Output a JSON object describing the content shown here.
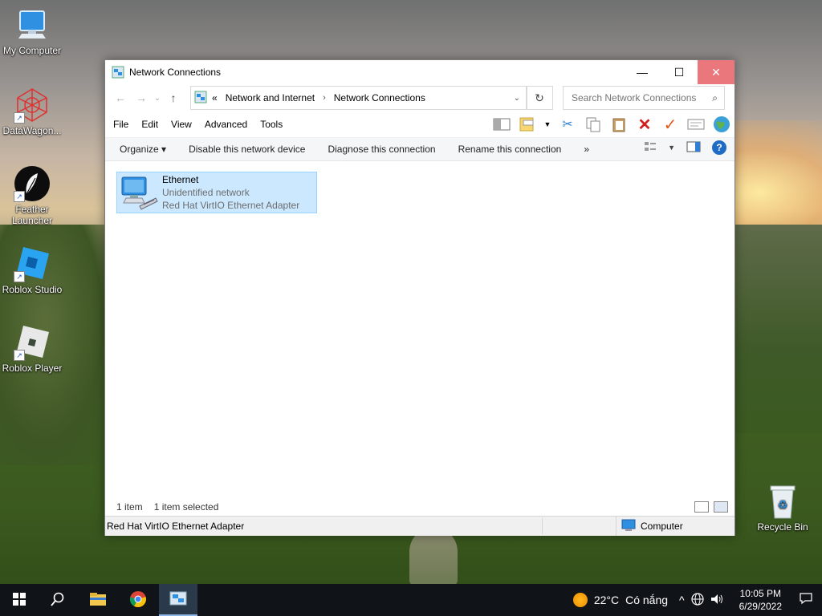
{
  "desktop": {
    "icons": [
      {
        "label": "My Computer",
        "icon": "monitor-icon"
      },
      {
        "label": "DataWagon...",
        "icon": "datawagon-icon"
      },
      {
        "label": "Feather Launcher",
        "icon": "feather-icon"
      },
      {
        "label": "Roblox Studio",
        "icon": "roblox-studio-icon"
      },
      {
        "label": "Roblox Player",
        "icon": "roblox-player-icon"
      },
      {
        "label": "Recycle Bin",
        "icon": "recycle-bin-icon"
      }
    ]
  },
  "window": {
    "title": "Network Connections",
    "controls": {
      "minimize": "—",
      "maximize": "☐",
      "close": "✕"
    },
    "nav": {
      "back": "←",
      "forward": "→",
      "recent": "⌄",
      "up": "↑"
    },
    "address": {
      "prefix": "«",
      "crumbs": [
        "Network and Internet",
        "Network Connections"
      ]
    },
    "search": {
      "placeholder": "Search Network Connections"
    },
    "menu": [
      "File",
      "Edit",
      "View",
      "Advanced",
      "Tools"
    ],
    "commands": [
      "Organize ▾",
      "Disable this network device",
      "Diagnose this connection",
      "Rename this connection",
      "»"
    ],
    "items": [
      {
        "name": "Ethernet",
        "status": "Unidentified network",
        "adapter": "Red Hat VirtIO Ethernet Adapter",
        "selected": true
      }
    ],
    "status": {
      "count": "1 item",
      "selection": "1 item selected"
    },
    "details": {
      "left": "Red Hat VirtIO Ethernet Adapter",
      "right": "Computer"
    }
  },
  "taskbar": {
    "weather": {
      "temp": "22°C",
      "condition": "Có nắng"
    },
    "clock": {
      "time": "10:05 PM",
      "date": "6/29/2022"
    },
    "tray": {
      "chevron": "^"
    }
  },
  "colors": {
    "selection_bg": "#cce8ff",
    "close_hover": "#e9777c",
    "taskbar": "#101418",
    "help_blue": "#1f6cc6"
  }
}
